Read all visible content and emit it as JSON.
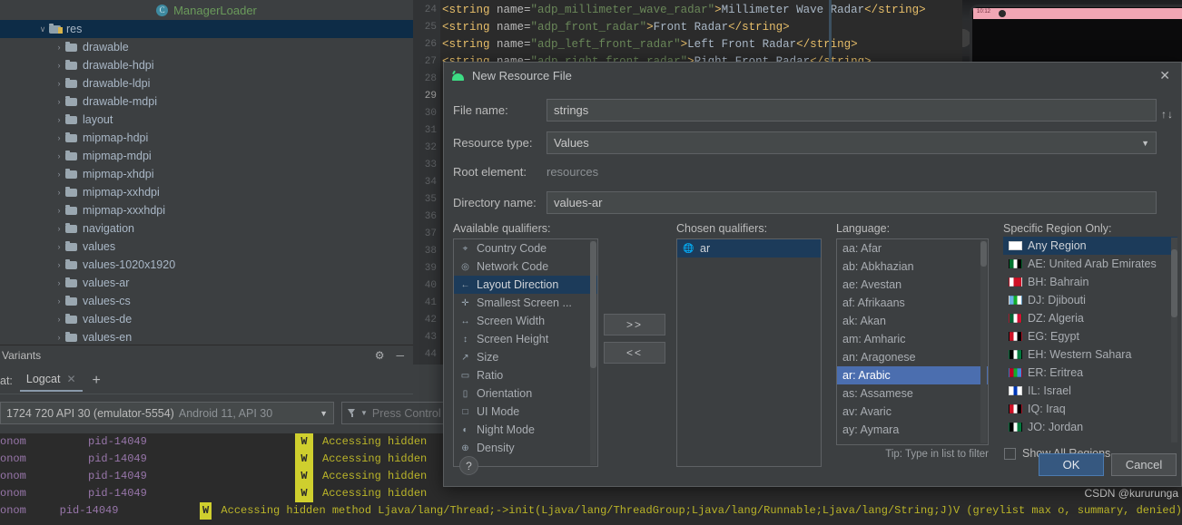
{
  "project_tree": {
    "tab_label": "ManagerLoader",
    "items": [
      {
        "label": "res",
        "depth": 0,
        "selected": true,
        "expanded": true
      },
      {
        "label": "drawable",
        "depth": 1,
        "selected": false,
        "expanded": false
      },
      {
        "label": "drawable-hdpi",
        "depth": 1,
        "selected": false,
        "expanded": false
      },
      {
        "label": "drawable-ldpi",
        "depth": 1,
        "selected": false,
        "expanded": false
      },
      {
        "label": "drawable-mdpi",
        "depth": 1,
        "selected": false,
        "expanded": false
      },
      {
        "label": "layout",
        "depth": 1,
        "selected": false,
        "expanded": false
      },
      {
        "label": "mipmap-hdpi",
        "depth": 1,
        "selected": false,
        "expanded": false
      },
      {
        "label": "mipmap-mdpi",
        "depth": 1,
        "selected": false,
        "expanded": false
      },
      {
        "label": "mipmap-xhdpi",
        "depth": 1,
        "selected": false,
        "expanded": false
      },
      {
        "label": "mipmap-xxhdpi",
        "depth": 1,
        "selected": false,
        "expanded": false
      },
      {
        "label": "mipmap-xxxhdpi",
        "depth": 1,
        "selected": false,
        "expanded": false
      },
      {
        "label": "navigation",
        "depth": 1,
        "selected": false,
        "expanded": false
      },
      {
        "label": "values",
        "depth": 1,
        "selected": false,
        "expanded": false
      },
      {
        "label": "values-1020x1920",
        "depth": 1,
        "selected": false,
        "expanded": false
      },
      {
        "label": "values-ar",
        "depth": 1,
        "selected": false,
        "expanded": false
      },
      {
        "label": "values-cs",
        "depth": 1,
        "selected": false,
        "expanded": false
      },
      {
        "label": "values-de",
        "depth": 1,
        "selected": false,
        "expanded": false
      },
      {
        "label": "values-en",
        "depth": 1,
        "selected": false,
        "expanded": false
      }
    ]
  },
  "variants_panel": {
    "title": "Variants"
  },
  "editor": {
    "line_numbers": [
      "24",
      "25",
      "26",
      "27",
      "28",
      "29",
      "30",
      "31",
      "32",
      "33",
      "34",
      "35",
      "36",
      "37",
      "38",
      "39",
      "40",
      "41",
      "42",
      "43",
      "44"
    ],
    "current_line": "29",
    "lines": [
      {
        "indent": "",
        "name_attr": "adp_millimeter_wave_radar",
        "value": "Millimeter Wave Radar"
      },
      {
        "indent": "",
        "name_attr": "adp_front_radar",
        "value": "Front Radar"
      },
      {
        "indent": "",
        "name_attr": "adp_left_front_radar",
        "value": "Left Front Radar"
      },
      {
        "indent": "",
        "name_attr": "adp_right_front_radar",
        "value": "Right Front Radar"
      }
    ]
  },
  "dialog": {
    "title": "New Resource File",
    "close_icon": "✕",
    "swap_icon": "↑↓",
    "fields": {
      "file_name_label": "File name:",
      "file_name_value": "strings",
      "resource_type_label": "Resource type:",
      "resource_type_value": "Values",
      "root_element_label": "Root element:",
      "root_element_value": "resources",
      "directory_name_label": "Directory name:",
      "directory_name_value": "values-ar"
    },
    "available_qualifiers": {
      "label": "Available qualifiers:",
      "items": [
        {
          "label": "Country Code",
          "icon": "globe-code-icon",
          "selected": false
        },
        {
          "label": "Network Code",
          "icon": "network-code-icon",
          "selected": false
        },
        {
          "label": "Layout Direction",
          "icon": "layout-direction-icon",
          "selected": true
        },
        {
          "label": "Smallest Screen ...",
          "icon": "smallest-screen-icon",
          "selected": false
        },
        {
          "label": "Screen Width",
          "icon": "screen-width-icon",
          "selected": false
        },
        {
          "label": "Screen Height",
          "icon": "screen-height-icon",
          "selected": false
        },
        {
          "label": "Size",
          "icon": "size-icon",
          "selected": false
        },
        {
          "label": "Ratio",
          "icon": "ratio-icon",
          "selected": false
        },
        {
          "label": "Orientation",
          "icon": "orientation-icon",
          "selected": false
        },
        {
          "label": "UI Mode",
          "icon": "ui-mode-icon",
          "selected": false
        },
        {
          "label": "Night Mode",
          "icon": "night-mode-icon",
          "selected": false
        },
        {
          "label": "Density",
          "icon": "density-icon",
          "selected": false
        }
      ]
    },
    "move_right_button": ">>",
    "move_left_button": "<<",
    "chosen_qualifiers": {
      "label": "Chosen qualifiers:",
      "items": [
        {
          "label": "ar",
          "icon": "globe-icon",
          "selected": true
        }
      ]
    },
    "language": {
      "label": "Language:",
      "items": [
        {
          "label": "aa: Afar",
          "selected": false
        },
        {
          "label": "ab: Abkhazian",
          "selected": false
        },
        {
          "label": "ae: Avestan",
          "selected": false
        },
        {
          "label": "af: Afrikaans",
          "selected": false
        },
        {
          "label": "ak: Akan",
          "selected": false
        },
        {
          "label": "am: Amharic",
          "selected": false
        },
        {
          "label": "an: Aragonese",
          "selected": false
        },
        {
          "label": "ar: Arabic",
          "selected": true
        },
        {
          "label": "as: Assamese",
          "selected": false
        },
        {
          "label": "av: Avaric",
          "selected": false
        },
        {
          "label": "ay: Aymara",
          "selected": false
        }
      ],
      "tip": "Tip: Type in list to filter"
    },
    "region": {
      "label": "Specific Region Only:",
      "items": [
        {
          "label": "Any Region",
          "selected": true,
          "flag1": "#ffffff",
          "flag2": "#ffffff",
          "flag3": "#ffffff"
        },
        {
          "label": "AE: United Arab Emirates",
          "selected": false,
          "flag1": "#00732f",
          "flag2": "#ffffff",
          "flag3": "#000000"
        },
        {
          "label": "BH: Bahrain",
          "selected": false,
          "flag1": "#ffffff",
          "flag2": "#ce1126",
          "flag3": "#ce1126"
        },
        {
          "label": "DJ: Djibouti",
          "selected": false,
          "flag1": "#6ab2e7",
          "flag2": "#12ad2b",
          "flag3": "#ffffff"
        },
        {
          "label": "DZ: Algeria",
          "selected": false,
          "flag1": "#006233",
          "flag2": "#ffffff",
          "flag3": "#d21034"
        },
        {
          "label": "EG: Egypt",
          "selected": false,
          "flag1": "#ce1126",
          "flag2": "#ffffff",
          "flag3": "#000000"
        },
        {
          "label": "EH: Western Sahara",
          "selected": false,
          "flag1": "#000000",
          "flag2": "#ffffff",
          "flag3": "#007a3d"
        },
        {
          "label": "ER: Eritrea",
          "selected": false,
          "flag1": "#be0027",
          "flag2": "#12ad2b",
          "flag3": "#4189dd"
        },
        {
          "label": "IL: Israel",
          "selected": false,
          "flag1": "#ffffff",
          "flag2": "#0038b8",
          "flag3": "#ffffff"
        },
        {
          "label": "IQ: Iraq",
          "selected": false,
          "flag1": "#ce1126",
          "flag2": "#ffffff",
          "flag3": "#000000"
        },
        {
          "label": "JO: Jordan",
          "selected": false,
          "flag1": "#000000",
          "flag2": "#ffffff",
          "flag3": "#007a3d"
        }
      ],
      "show_all_label": "Show All Regions",
      "show_all_checked": false
    },
    "help_button": "?",
    "ok_button": "OK",
    "cancel_button": "Cancel"
  },
  "logcat": {
    "prefix_label": "at:",
    "tab_label": "Logcat",
    "close_icon": "✕",
    "add_icon": "+",
    "device_combo": "1724 720 API 30 (emulator-5554)",
    "device_combo_dim": "Android 11, API 30",
    "filter_placeholder": "Press Control",
    "rows": [
      {
        "tag": "onom",
        "pid": "pid-14049",
        "level": "W",
        "message": "Accessing hidden"
      },
      {
        "tag": "onom",
        "pid": "pid-14049",
        "level": "W",
        "message": "Accessing hidden"
      },
      {
        "tag": "onom",
        "pid": "pid-14049",
        "level": "W",
        "message": "Accessing hidden"
      },
      {
        "tag": "onom",
        "pid": "pid-14049",
        "level": "W",
        "message": "Accessing hidden"
      },
      {
        "tag": "onom",
        "pid": "pid-14049",
        "level": "W",
        "message": "Accessing hidden method Ljava/lang/Thread;->init(Ljava/lang/ThreadGroup;Ljava/lang/Runnable;Ljava/lang/String;J)V (greylist max o, summary, denied)"
      }
    ]
  },
  "watermark": "CSDN @kururunga",
  "colors": {
    "panel_bg": "#3c3f41",
    "editor_bg": "#2b2b2b",
    "selection_blue": "#4b6eaf",
    "selection_navy": "#1c3b5a",
    "tree_selection": "#0d2c47",
    "accent_green": "#6a9a5b",
    "warn_yellow": "#bbb529",
    "ok_button": "#365880"
  }
}
